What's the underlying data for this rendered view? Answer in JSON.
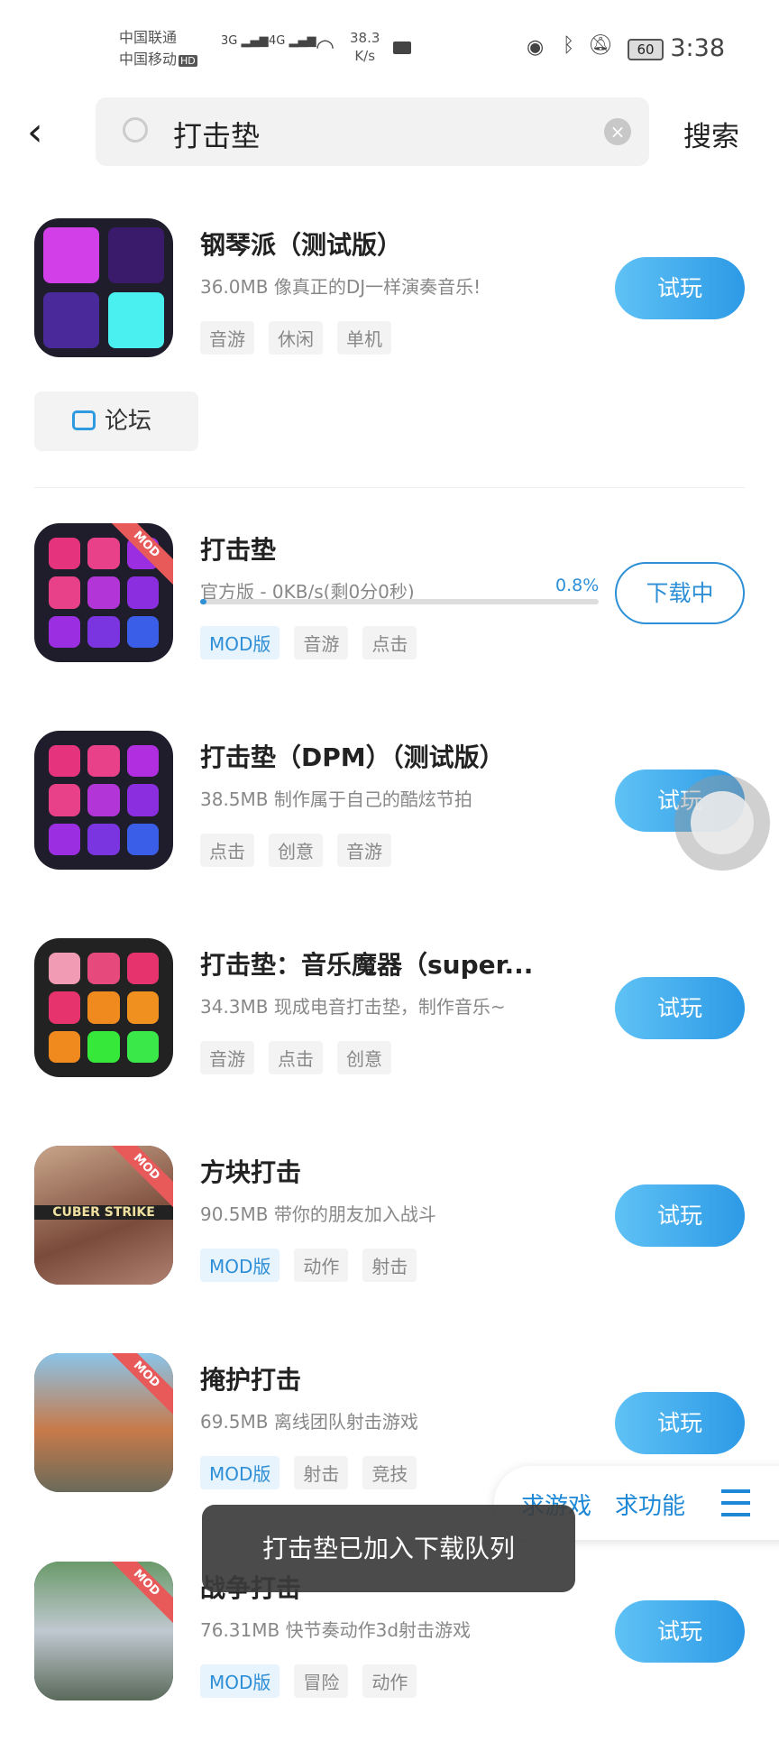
{
  "status_bar": {
    "carrier1": "中国联通",
    "carrier2": "中国移动",
    "hd": "HD",
    "net1": "3G",
    "net2": "4G",
    "speed": "38.3",
    "speed_unit": "K/s",
    "battery": "60",
    "time": "3:38"
  },
  "header": {
    "search_value": "打击垫",
    "search_button": "搜索"
  },
  "forum_label": "论坛",
  "items": [
    {
      "title": "钢琴派（测试版）",
      "subtitle": "36.0MB  像真正的DJ一样演奏音乐!",
      "tags": [
        "音游",
        "休闲",
        "单机"
      ],
      "button": "试玩",
      "mod": false
    },
    {
      "title": "打击垫",
      "subtitle": "官方版 - 0KB/s(剩0分0秒)",
      "progress": "0.8%",
      "tags": [
        "MOD版",
        "音游",
        "点击"
      ],
      "button": "下载中",
      "mod": true
    },
    {
      "title": "打击垫（DPM）（测试版）",
      "subtitle": "38.5MB  制作属于自己的酷炫节拍",
      "tags": [
        "点击",
        "创意",
        "音游"
      ],
      "button": "试玩",
      "mod": false
    },
    {
      "title": "打击垫：音乐魔器（super...",
      "subtitle": "34.3MB  现成电音打击垫，制作音乐~",
      "tags": [
        "音游",
        "点击",
        "创意"
      ],
      "button": "试玩",
      "mod": false
    },
    {
      "title": "方块打击",
      "subtitle": "90.5MB  带你的朋友加入战斗",
      "tags": [
        "MOD版",
        "动作",
        "射击"
      ],
      "button": "试玩",
      "mod": true,
      "icon_text": "CUBER STRIKE"
    },
    {
      "title": "掩护打击",
      "subtitle": "69.5MB  离线团队射击游戏",
      "tags": [
        "MOD版",
        "射击",
        "竞技"
      ],
      "button": "试玩",
      "mod": true
    },
    {
      "title": "战争打击",
      "subtitle": "76.31MB  快节奏动作3d射击游戏",
      "tags": [
        "MOD版",
        "冒险",
        "动作"
      ],
      "button": "试玩",
      "mod": true
    }
  ],
  "mod_ribbon": "MOD",
  "float_bar": {
    "request_game": "求游戏",
    "request_feature": "求功能"
  },
  "toast": "打击垫已加入下载队列",
  "colors": {
    "accent": "#2d9ae6",
    "mod_tag": "#2e8ed6"
  }
}
